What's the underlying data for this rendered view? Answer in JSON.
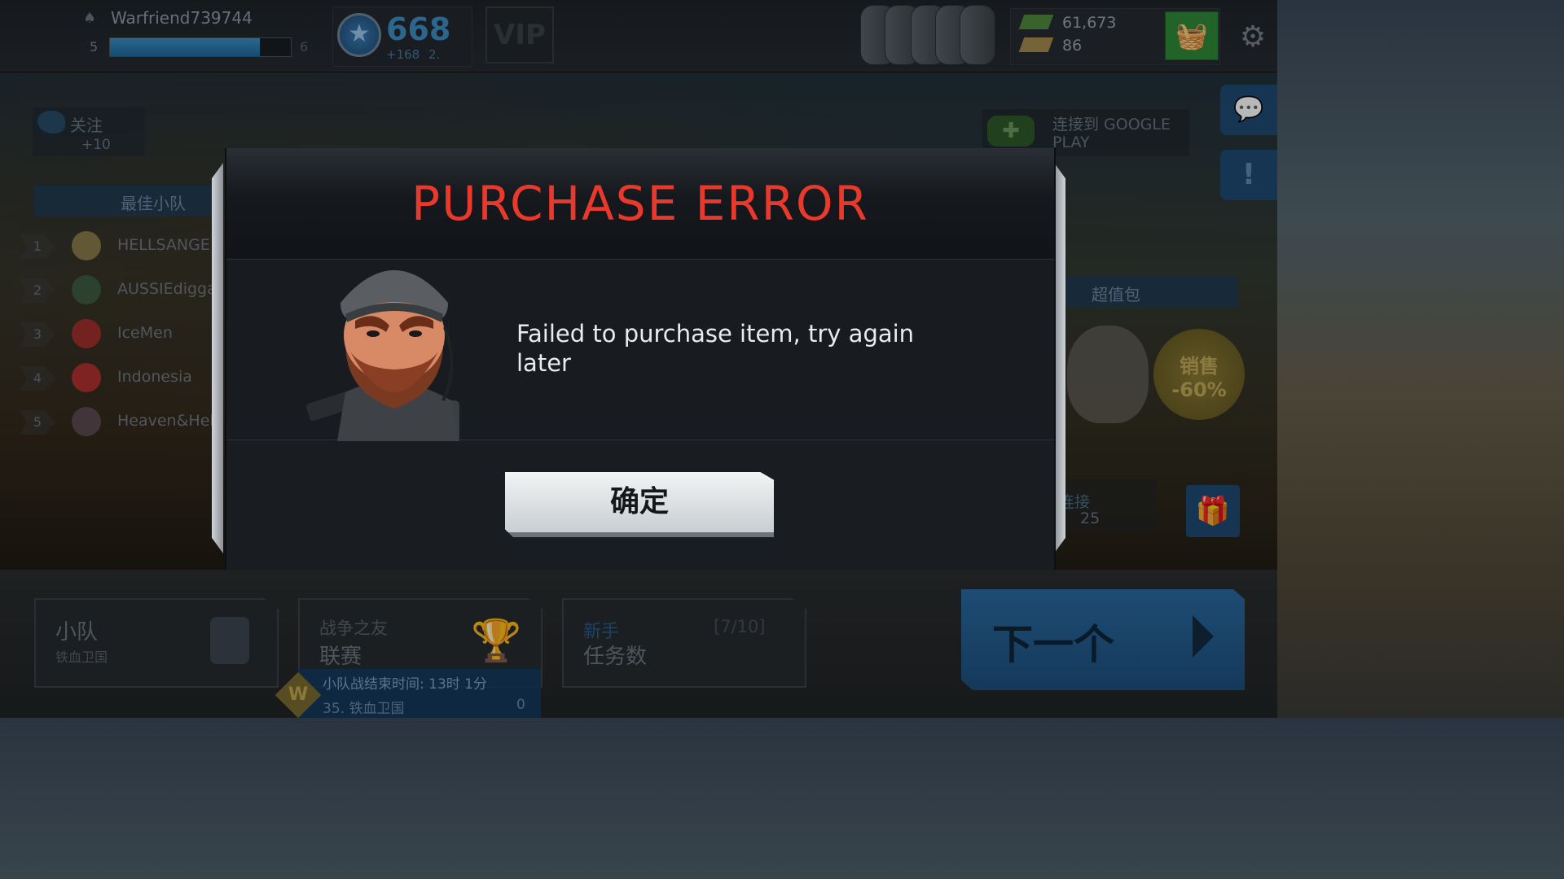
{
  "topbar": {
    "player_name": "Warfriend739744",
    "level_current": "5",
    "level_next": "6",
    "xp_progress_percent": 83,
    "rank_value": "668",
    "rank_delta": "+168",
    "rank_sub": "2.",
    "vip_label": "VIP",
    "cash": "61,673",
    "gold": "86"
  },
  "left_panel": {
    "follow_label": "关注",
    "follow_reward": "+10",
    "best_squads_title": "最佳小队",
    "squads": [
      {
        "rank": "1",
        "name": "HELLSANGE"
      },
      {
        "rank": "2",
        "name": "AUSSIEdigga"
      },
      {
        "rank": "3",
        "name": "IceMen"
      },
      {
        "rank": "4",
        "name": "Indonesia"
      },
      {
        "rank": "5",
        "name": "Heaven&Hell"
      }
    ]
  },
  "right_panel": {
    "google_play_label": "连接到 GOOGLE PLAY",
    "deal_title": "超值包",
    "sale_line1": "销售",
    "sale_line2": "-60%",
    "connect_label": "连接",
    "connect_reward": "25"
  },
  "bottom": {
    "squad_card_title": "小队",
    "squad_card_sub": "铁血卫国",
    "league_card_sub": "战争之友",
    "league_card_title": "联赛",
    "league_time": "小队战结束时间: 13时 1分",
    "league_rank": "35. 铁血卫国",
    "league_count": "0",
    "league_badge": "W",
    "mission_label": "新手",
    "mission_count": "[7/10]",
    "mission_title": "任务数",
    "next_label": "下一个"
  },
  "modal": {
    "title": "PURCHASE ERROR",
    "message": "Failed to purchase item, try again later",
    "ok_label": "确定"
  },
  "colors": {
    "title_red": "#e8392c",
    "accent_blue": "#1d4f7c",
    "shop_green": "#2f8a3a"
  },
  "icons": [
    "player-icon",
    "rank-star-icon",
    "dogtags-icon",
    "cash-icon",
    "gold-icon",
    "shop-basket-icon",
    "gear-icon",
    "twitter-icon",
    "gamepad-icon",
    "chat-icon",
    "alert-icon",
    "gift-icon",
    "trophy-icon",
    "next-arrow-icon"
  ]
}
